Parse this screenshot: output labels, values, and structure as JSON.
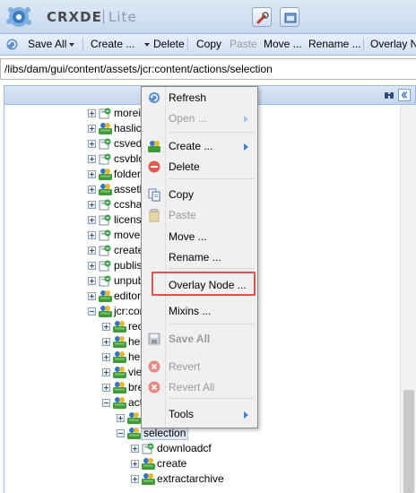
{
  "app": {
    "logo_text": "CRXDE",
    "logo_sub": "Lite"
  },
  "toolbar": {
    "save_all": "Save All",
    "create": "Create ...",
    "delete": "Delete",
    "copy": "Copy",
    "paste": "Paste",
    "move": "Move ...",
    "rename": "Rename ...",
    "overlay": "Overlay No"
  },
  "path": {
    "value": "/libs/dam/gui/content/assets/jcr:content/actions/selection"
  },
  "tree": {
    "nodes": [
      {
        "label": "moreir",
        "icon": "node-icon",
        "expander": "plus"
      },
      {
        "label": "haslic",
        "icon": "folder-node-icon",
        "expander": "plus"
      },
      {
        "label": "csved",
        "icon": "node-icon",
        "expander": "plus"
      },
      {
        "label": "csvblc",
        "icon": "node-icon",
        "expander": "plus"
      },
      {
        "label": "folder",
        "icon": "folder-node-icon",
        "expander": "plus"
      },
      {
        "label": "assetl",
        "icon": "folder-node-icon",
        "expander": "plus"
      },
      {
        "label": "ccsha",
        "icon": "node-icon",
        "expander": "plus"
      },
      {
        "label": "licens",
        "icon": "node-icon",
        "expander": "plus"
      },
      {
        "label": "movea",
        "icon": "node-icon",
        "expander": "plus"
      },
      {
        "label": "create",
        "icon": "node-icon",
        "expander": "plus"
      },
      {
        "label": "publis",
        "icon": "node-icon",
        "expander": "plus"
      },
      {
        "label": "unpub",
        "icon": "node-icon",
        "expander": "plus"
      },
      {
        "label": "editor",
        "icon": "folder-node-icon",
        "expander": "plus"
      },
      {
        "label": "jcr:cor",
        "icon": "folder-node-icon",
        "expander": "minus"
      },
      {
        "label": "rec",
        "icon": "folder-node-icon",
        "expander": "plus"
      },
      {
        "label": "he",
        "icon": "folder-node-icon",
        "expander": "plus"
      },
      {
        "label": "he",
        "icon": "folder-node-icon",
        "expander": "plus"
      },
      {
        "label": "vie",
        "icon": "folder-node-icon",
        "expander": "plus"
      },
      {
        "label": "bre",
        "icon": "folder-node-icon",
        "expander": "plus"
      },
      {
        "label": "act",
        "icon": "folder-node-icon",
        "expander": "minus"
      },
      {
        "label": "",
        "icon": "folder-node-icon",
        "expander": "plus"
      },
      {
        "label": "selection",
        "icon": "folder-node-icon",
        "expander": "minus"
      },
      {
        "label": "downloadcf",
        "icon": "node-icon",
        "expander": "plus"
      },
      {
        "label": "create",
        "icon": "folder-node-icon",
        "expander": "plus"
      },
      {
        "label": "extractarchive",
        "icon": "folder-node-icon",
        "expander": "plus"
      }
    ]
  },
  "context_menu": {
    "items": [
      {
        "label": "Refresh",
        "icon": "refresh-icon",
        "enabled": true
      },
      {
        "label": "Open ...",
        "icon": "",
        "enabled": false,
        "submenu": true
      },
      {
        "label": "Create ...",
        "icon": "create-node-icon",
        "enabled": true,
        "submenu": true
      },
      {
        "label": "Delete",
        "icon": "delete-icon",
        "enabled": true
      },
      {
        "label": "Copy",
        "icon": "copy-icon",
        "enabled": true
      },
      {
        "label": "Paste",
        "icon": "paste-icon",
        "enabled": false
      },
      {
        "label": "Move ...",
        "icon": "",
        "enabled": true
      },
      {
        "label": "Rename ...",
        "icon": "",
        "enabled": true
      },
      {
        "label": "Overlay Node ...",
        "icon": "",
        "enabled": true,
        "highlighted": true
      },
      {
        "label": "Mixins ...",
        "icon": "",
        "enabled": true
      },
      {
        "label": "Save All",
        "icon": "save-icon",
        "enabled": false
      },
      {
        "label": "Revert",
        "icon": "revert-icon",
        "enabled": false
      },
      {
        "label": "Revert All",
        "icon": "revert-all-icon",
        "enabled": false
      },
      {
        "label": "Tools",
        "icon": "",
        "enabled": true,
        "submenu": true
      }
    ]
  },
  "colors": {
    "highlight_border": "#d9534f",
    "accent_blue": "#3c82d8",
    "panel_border": "#99bbe8"
  }
}
